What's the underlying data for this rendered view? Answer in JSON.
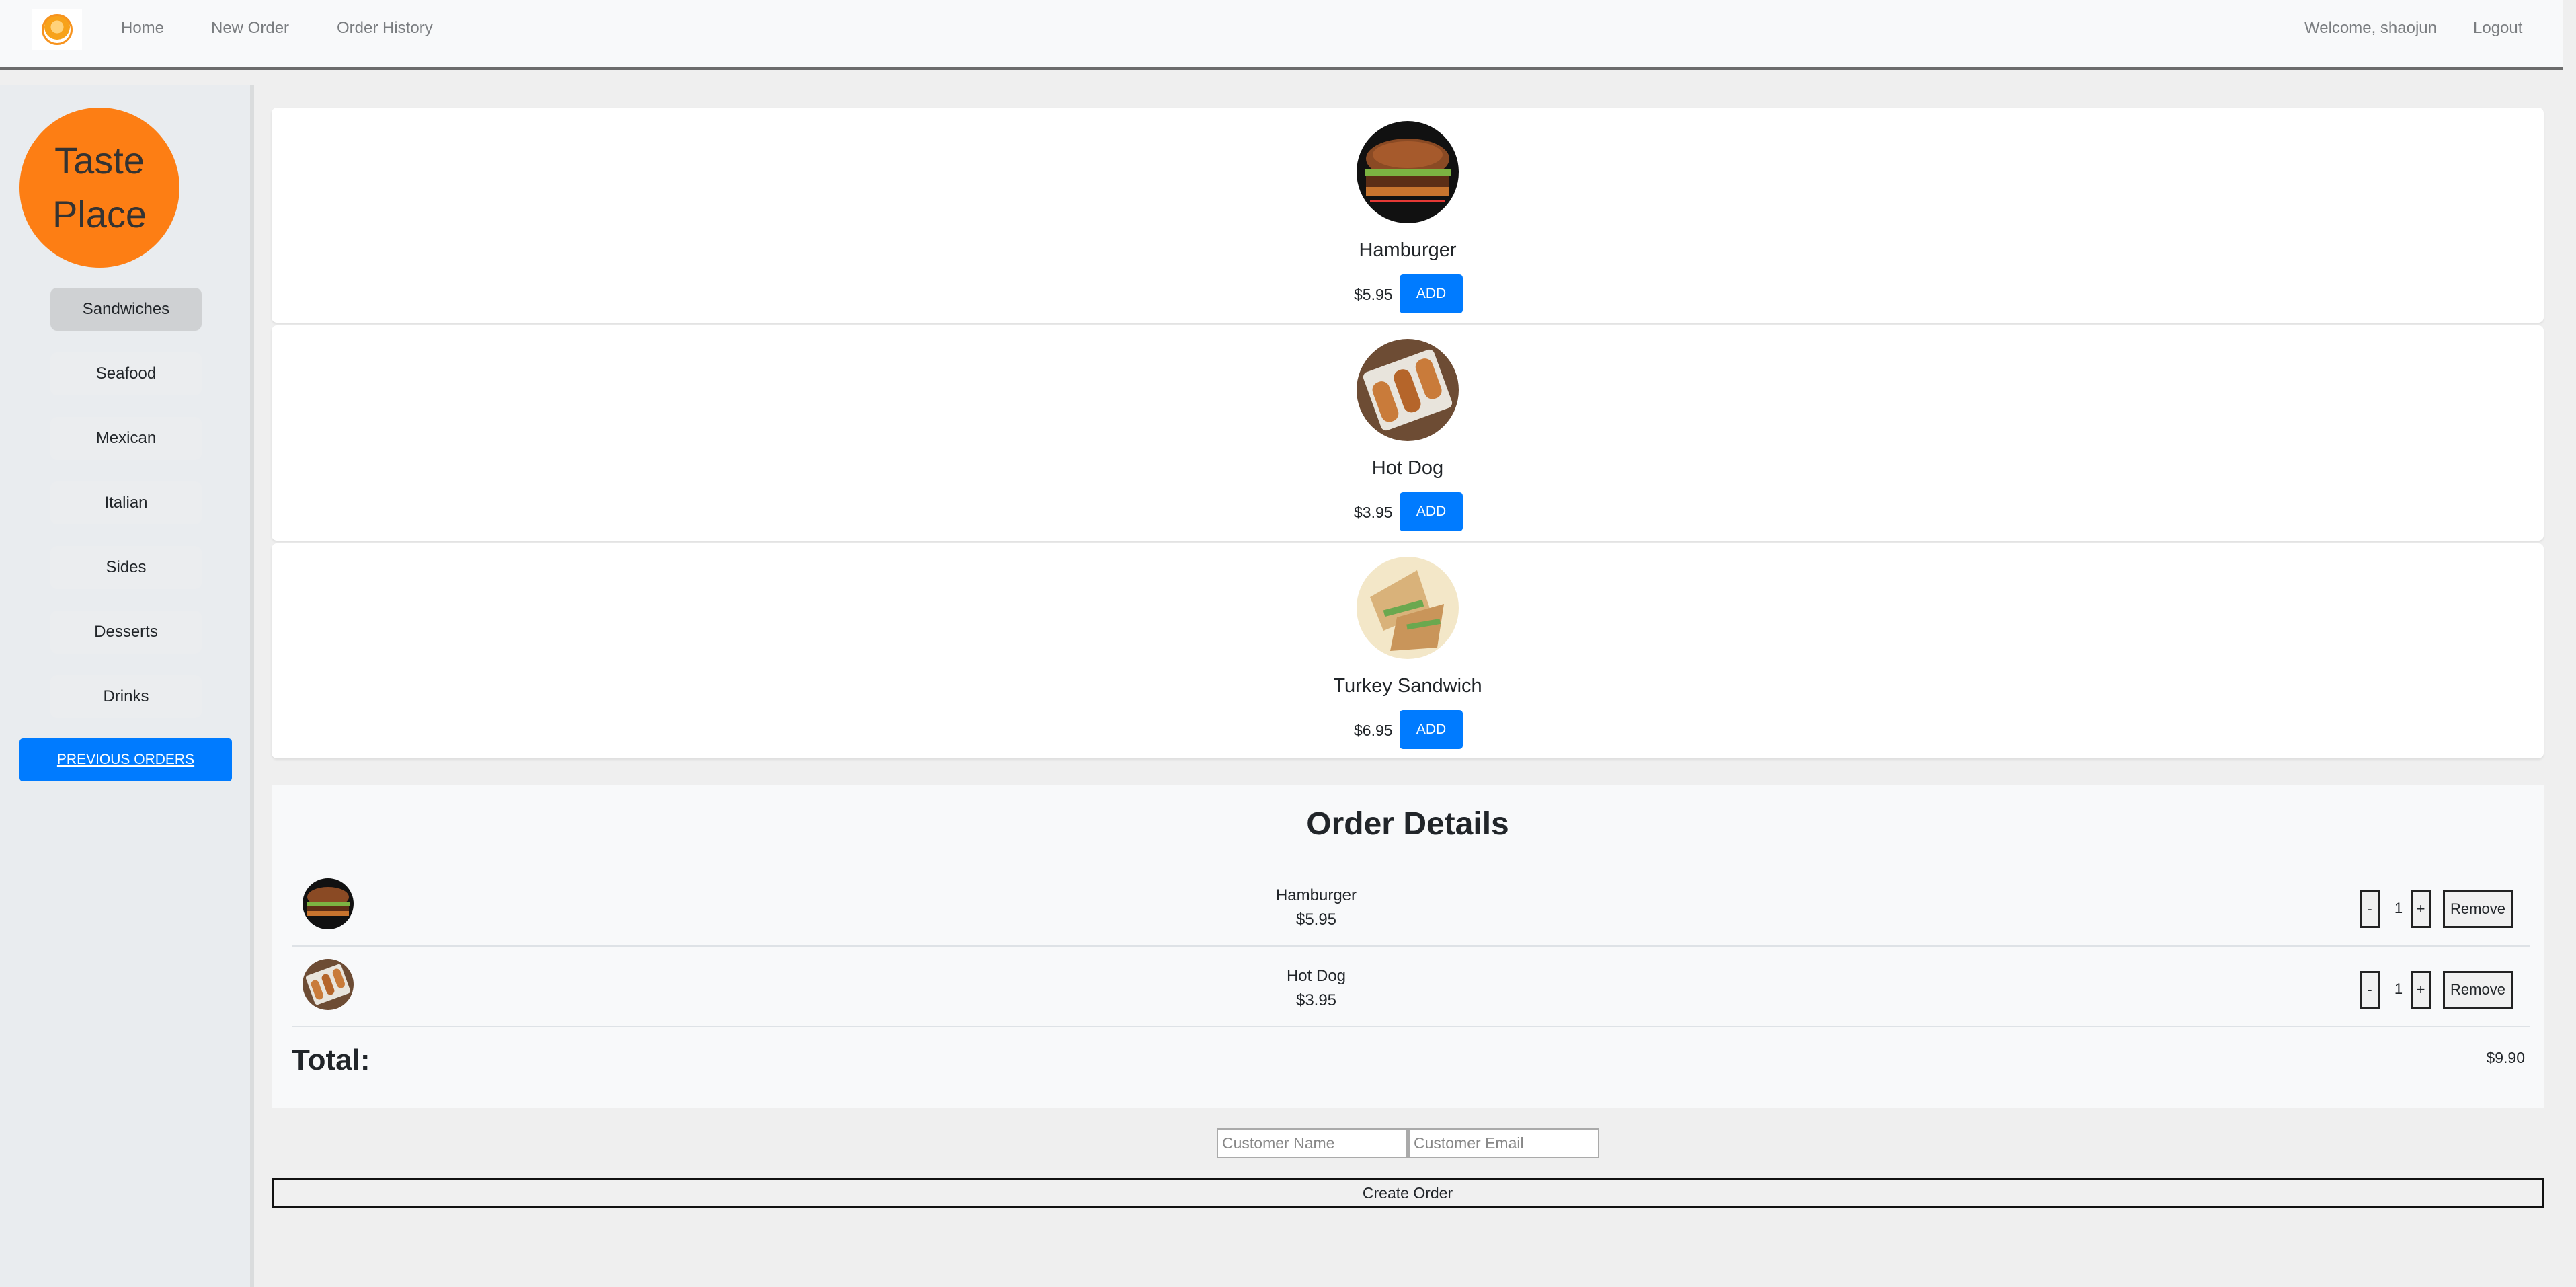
{
  "navbar": {
    "links": [
      "Home",
      "New Order",
      "Order History"
    ],
    "welcome": "Welcome, shaojun",
    "logout": "Logout"
  },
  "sidebar": {
    "logo_line1": "Taste",
    "logo_line2": "Place",
    "categories": [
      "Sandwiches",
      "Seafood",
      "Mexican",
      "Italian",
      "Sides",
      "Desserts",
      "Drinks"
    ],
    "active_category": "Sandwiches",
    "previous_orders": "PREVIOUS ORDERS"
  },
  "menu": {
    "add_label": "ADD",
    "items": [
      {
        "name": "Hamburger",
        "price": "$5.95",
        "image": "hamburger-image"
      },
      {
        "name": "Hot Dog",
        "price": "$3.95",
        "image": "hotdog-image"
      },
      {
        "name": "Turkey Sandwich",
        "price": "$6.95",
        "image": "turkey-sandwich-image"
      }
    ]
  },
  "order": {
    "title": "Order Details",
    "rows": [
      {
        "name": "Hamburger",
        "price": "$5.95",
        "qty": "1"
      },
      {
        "name": "Hot Dog",
        "price": "$3.95",
        "qty": "1"
      }
    ],
    "minus": "-",
    "plus": "+",
    "remove": "Remove",
    "total_label": "Total:",
    "total_value": "$9.90"
  },
  "form": {
    "name_placeholder": "Customer Name",
    "email_placeholder": "Customer Email",
    "create_label": "Create Order"
  },
  "colors": {
    "accent": "#007bff",
    "logo": "#fd7e14"
  }
}
